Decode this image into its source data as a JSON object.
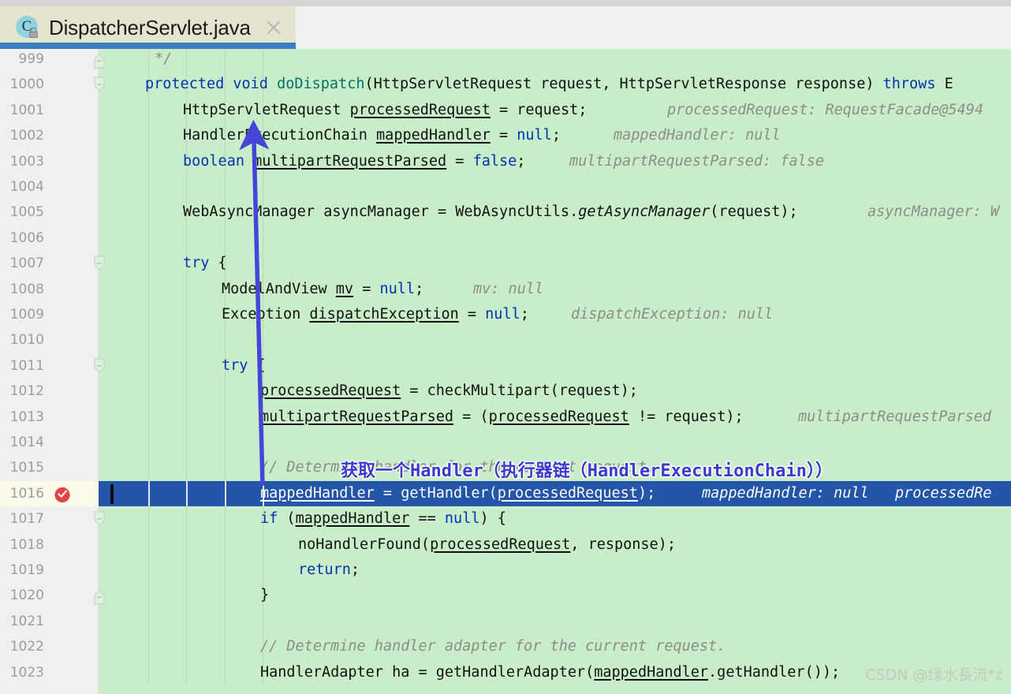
{
  "tab": {
    "title": "DispatcherServlet.java",
    "icon_name": "java-class-icon",
    "icon_letter": "C",
    "lock_icon": "lock-icon",
    "close_icon": "close-icon",
    "accent_color": "#3d7ec0",
    "background_color": "#e5e5cf"
  },
  "editor": {
    "background_color": "#c8edc8",
    "gutter_color": "#f0f0f0",
    "selection_color": "#2355a8",
    "keyword_color": "#0033b3",
    "comment_color": "#8c8c8c",
    "hint_color": "#8c8c8c",
    "selected_line_number": 1016,
    "first_line": 999,
    "last_line": 1023,
    "breakpoint": {
      "line": 1016,
      "color": "#e04444",
      "icon": "breakpoint-verified-icon"
    },
    "caret_line": 1016
  },
  "lines": [
    {
      "n": 999,
      "indent": 60,
      "fold": "end",
      "code": "*/",
      "type": "comment"
    },
    {
      "n": 1000,
      "indent": 0,
      "fold": "start",
      "code": "protected void doDispatch(HttpServletRequest request, HttpServletResponse response) throws E",
      "type": "signature"
    },
    {
      "n": 1001,
      "indent": 0,
      "fold": "",
      "code": "HttpServletRequest processedRequest = request;",
      "hint": "processedRequest: RequestFacade@5494"
    },
    {
      "n": 1002,
      "indent": 0,
      "fold": "",
      "code": "HandlerExecutionChain mappedHandler = null;",
      "hint": "mappedHandler: null"
    },
    {
      "n": 1003,
      "indent": 0,
      "fold": "",
      "code": "boolean multipartRequestParsed = false;",
      "hint": "multipartRequestParsed: false"
    },
    {
      "n": 1004,
      "indent": 0,
      "fold": "",
      "code": ""
    },
    {
      "n": 1005,
      "indent": 0,
      "fold": "",
      "code": "WebAsyncManager asyncManager = WebAsyncUtils.getAsyncManager(request);",
      "hint": "asyncManager: W"
    },
    {
      "n": 1006,
      "indent": 0,
      "fold": "",
      "code": ""
    },
    {
      "n": 1007,
      "indent": 0,
      "fold": "start",
      "code": "try {"
    },
    {
      "n": 1008,
      "indent": 0,
      "fold": "",
      "code": "ModelAndView mv = null;",
      "hint": "mv: null"
    },
    {
      "n": 1009,
      "indent": 0,
      "fold": "",
      "code": "Exception dispatchException = null;",
      "hint": "dispatchException: null"
    },
    {
      "n": 1010,
      "indent": 0,
      "fold": "",
      "code": ""
    },
    {
      "n": 1011,
      "indent": 0,
      "fold": "start",
      "code": "try {"
    },
    {
      "n": 1012,
      "indent": 0,
      "fold": "",
      "code": "processedRequest = checkMultipart(request);"
    },
    {
      "n": 1013,
      "indent": 0,
      "fold": "",
      "code": "multipartRequestParsed = (processedRequest != request);",
      "hint": "multipartRequestParsed"
    },
    {
      "n": 1014,
      "indent": 0,
      "fold": "",
      "code": ""
    },
    {
      "n": 1015,
      "indent": 0,
      "fold": "",
      "code": "// Determine handler for the current request.",
      "type": "comment"
    },
    {
      "n": 1016,
      "indent": 0,
      "fold": "",
      "code": "mappedHandler = getHandler(processedRequest);",
      "hint": "mappedHandler: null   processedRe",
      "selected": true
    },
    {
      "n": 1017,
      "indent": 0,
      "fold": "start",
      "code": "if (mappedHandler == null) {"
    },
    {
      "n": 1018,
      "indent": 0,
      "fold": "",
      "code": "noHandlerFound(processedRequest, response);"
    },
    {
      "n": 1019,
      "indent": 0,
      "fold": "",
      "code": "return;"
    },
    {
      "n": 1020,
      "indent": 0,
      "fold": "end",
      "code": "}"
    },
    {
      "n": 1021,
      "indent": 0,
      "fold": "",
      "code": ""
    },
    {
      "n": 1022,
      "indent": 0,
      "fold": "",
      "code": "// Determine handler adapter for the current request.",
      "type": "comment"
    },
    {
      "n": 1023,
      "indent": 0,
      "fold": "",
      "code": "HandlerAdapter ha = getHandlerAdapter(mappedHandler.getHandler());"
    }
  ],
  "annotation": {
    "text": "获取一个Handler（执行器链（HandlerExecutionChain））",
    "color": "#3a3ad0",
    "outline_color": "#ffffff"
  },
  "arrow": {
    "name": "callout-arrow",
    "color": "#4545d8",
    "from_line": 1016,
    "to_line": 1002
  },
  "watermark": {
    "text": "CSDN @绿水長流*z",
    "color": "#c6c6c6"
  }
}
